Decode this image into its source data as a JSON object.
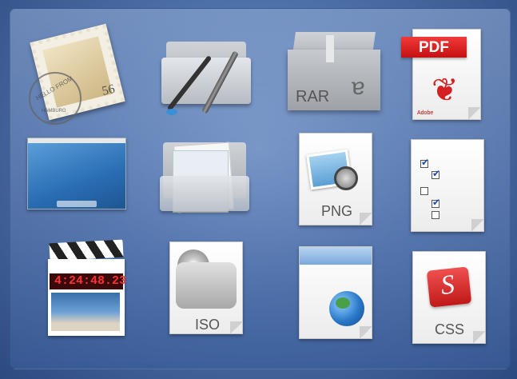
{
  "icons": [
    {
      "name": "mail-stamp",
      "stamp_text": "HELLO FROM",
      "stamp_value": "56",
      "city": "HAMBURG"
    },
    {
      "name": "developer-folder"
    },
    {
      "name": "rar-archive",
      "label": "RAR"
    },
    {
      "name": "pdf-document",
      "banner": "PDF",
      "brand": "Adobe"
    },
    {
      "name": "desktop-screenshot"
    },
    {
      "name": "documents-folder"
    },
    {
      "name": "png-image",
      "label": "PNG"
    },
    {
      "name": "checklist-document"
    },
    {
      "name": "movie-clapper",
      "timecode": "4:24:48.23"
    },
    {
      "name": "iso-disk-image",
      "label": "ISO"
    },
    {
      "name": "web-document"
    },
    {
      "name": "css-document",
      "label": "CSS"
    }
  ],
  "colors": {
    "accent": "#e02020",
    "background": "#4f72aa"
  }
}
